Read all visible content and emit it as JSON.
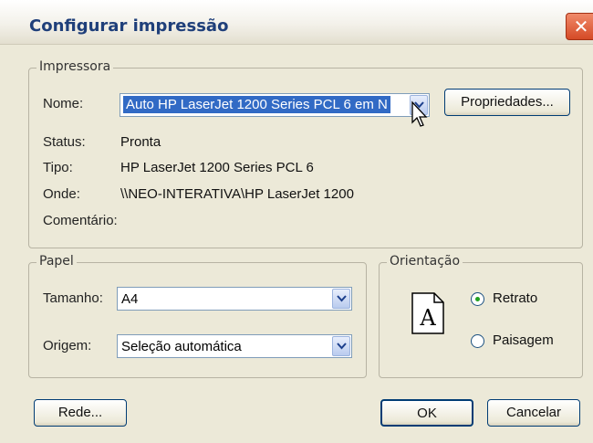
{
  "window": {
    "title": "Configurar impressão",
    "close_glyph": "✕"
  },
  "printer": {
    "legend": "Impressora",
    "name_label": "Nome:",
    "name_value": "Auto HP LaserJet 1200 Series PCL 6 em N",
    "properties_label": "Propriedades...",
    "status_label": "Status:",
    "status_value": "Pronta",
    "type_label": "Tipo:",
    "type_value": "HP LaserJet 1200 Series PCL 6",
    "where_label": "Onde:",
    "where_value": "\\\\NEO-INTERATIVA\\HP LaserJet 1200",
    "comment_label": "Comentário:",
    "comment_value": ""
  },
  "paper": {
    "legend": "Papel",
    "size_label": "Tamanho:",
    "size_value": "A4",
    "source_label": "Origem:",
    "source_value": "Seleção automática"
  },
  "orientation": {
    "legend": "Orientação",
    "icon_letter": "A",
    "options": [
      {
        "label": "Retrato",
        "selected": true
      },
      {
        "label": "Paisagem",
        "selected": false
      }
    ]
  },
  "buttons": {
    "network": "Rede...",
    "ok": "OK",
    "cancel": "Cancelar"
  },
  "colors": {
    "accent": "#316ac5",
    "title": "#1f3f7a",
    "radio_dot": "#21a121"
  }
}
